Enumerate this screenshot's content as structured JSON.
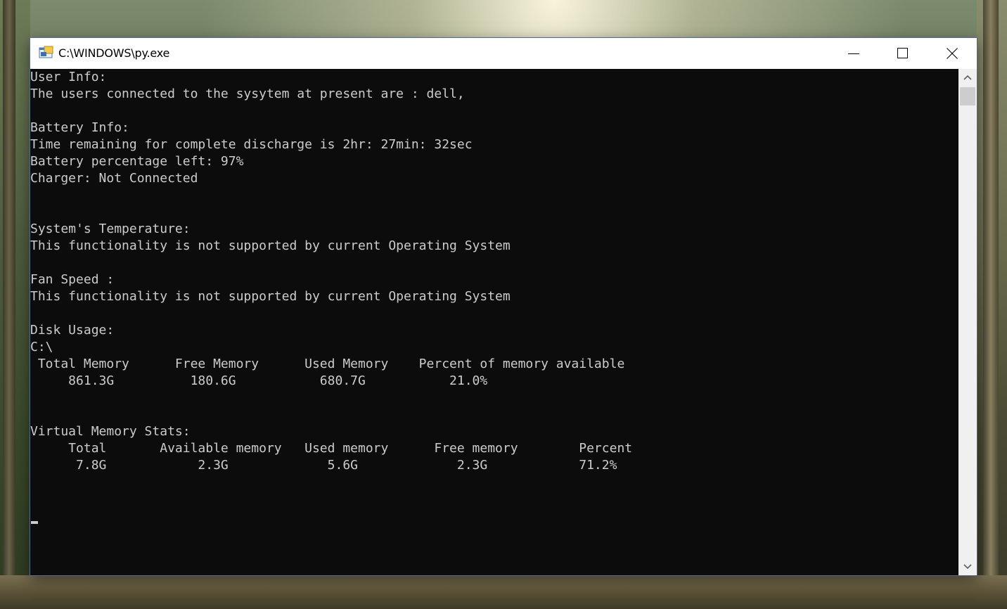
{
  "window": {
    "title": "C:\\WINDOWS\\py.exe",
    "controls": {
      "minimize": "minimize",
      "maximize": "maximize",
      "close": "close"
    }
  },
  "console": {
    "lines": [
      "User Info:",
      "The users connected to the sysytem at present are : dell,",
      "",
      "Battery Info:",
      "Time remaining for complete discharge is 2hr: 27min: 32sec",
      "Battery percentage left: 97%",
      "Charger: Not Connected",
      "",
      "",
      "System's Temperature:",
      "This functionality is not supported by current Operating System",
      "",
      "Fan Speed :",
      "This functionality is not supported by current Operating System",
      "",
      "Disk Usage:",
      "C:\\",
      " Total Memory      Free Memory      Used Memory    Percent of memory available",
      "     861.3G          180.6G           680.7G           21.0%",
      "",
      "",
      "Virtual Memory Stats:",
      "     Total       Available memory   Used memory      Free memory        Percent",
      "      7.8G            2.3G             5.6G             2.3G            71.2%"
    ]
  },
  "colors": {
    "console_bg": "#0c0c0c",
    "console_text": "#cccccc",
    "titlebar_bg": "#ffffff",
    "scrollbar_bg": "#f0f0f0"
  },
  "icons": {
    "app": "console-app-icon",
    "minimize": "minimize-icon",
    "maximize": "maximize-icon",
    "close": "close-icon",
    "scroll_up": "chevron-up-icon",
    "scroll_down": "chevron-down-icon"
  }
}
